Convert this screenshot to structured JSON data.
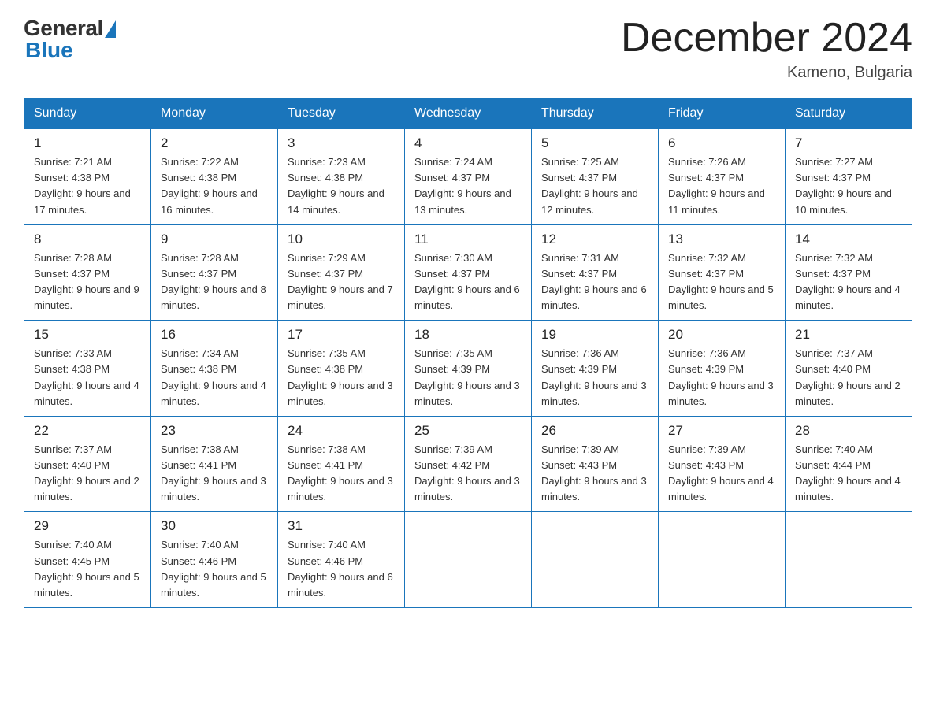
{
  "logo": {
    "general": "General",
    "blue": "Blue"
  },
  "title": "December 2024",
  "location": "Kameno, Bulgaria",
  "days_of_week": [
    "Sunday",
    "Monday",
    "Tuesday",
    "Wednesday",
    "Thursday",
    "Friday",
    "Saturday"
  ],
  "weeks": [
    [
      {
        "day": "1",
        "sunrise": "7:21 AM",
        "sunset": "4:38 PM",
        "daylight": "9 hours and 17 minutes."
      },
      {
        "day": "2",
        "sunrise": "7:22 AM",
        "sunset": "4:38 PM",
        "daylight": "9 hours and 16 minutes."
      },
      {
        "day": "3",
        "sunrise": "7:23 AM",
        "sunset": "4:38 PM",
        "daylight": "9 hours and 14 minutes."
      },
      {
        "day": "4",
        "sunrise": "7:24 AM",
        "sunset": "4:37 PM",
        "daylight": "9 hours and 13 minutes."
      },
      {
        "day": "5",
        "sunrise": "7:25 AM",
        "sunset": "4:37 PM",
        "daylight": "9 hours and 12 minutes."
      },
      {
        "day": "6",
        "sunrise": "7:26 AM",
        "sunset": "4:37 PM",
        "daylight": "9 hours and 11 minutes."
      },
      {
        "day": "7",
        "sunrise": "7:27 AM",
        "sunset": "4:37 PM",
        "daylight": "9 hours and 10 minutes."
      }
    ],
    [
      {
        "day": "8",
        "sunrise": "7:28 AM",
        "sunset": "4:37 PM",
        "daylight": "9 hours and 9 minutes."
      },
      {
        "day": "9",
        "sunrise": "7:28 AM",
        "sunset": "4:37 PM",
        "daylight": "9 hours and 8 minutes."
      },
      {
        "day": "10",
        "sunrise": "7:29 AM",
        "sunset": "4:37 PM",
        "daylight": "9 hours and 7 minutes."
      },
      {
        "day": "11",
        "sunrise": "7:30 AM",
        "sunset": "4:37 PM",
        "daylight": "9 hours and 6 minutes."
      },
      {
        "day": "12",
        "sunrise": "7:31 AM",
        "sunset": "4:37 PM",
        "daylight": "9 hours and 6 minutes."
      },
      {
        "day": "13",
        "sunrise": "7:32 AM",
        "sunset": "4:37 PM",
        "daylight": "9 hours and 5 minutes."
      },
      {
        "day": "14",
        "sunrise": "7:32 AM",
        "sunset": "4:37 PM",
        "daylight": "9 hours and 4 minutes."
      }
    ],
    [
      {
        "day": "15",
        "sunrise": "7:33 AM",
        "sunset": "4:38 PM",
        "daylight": "9 hours and 4 minutes."
      },
      {
        "day": "16",
        "sunrise": "7:34 AM",
        "sunset": "4:38 PM",
        "daylight": "9 hours and 4 minutes."
      },
      {
        "day": "17",
        "sunrise": "7:35 AM",
        "sunset": "4:38 PM",
        "daylight": "9 hours and 3 minutes."
      },
      {
        "day": "18",
        "sunrise": "7:35 AM",
        "sunset": "4:39 PM",
        "daylight": "9 hours and 3 minutes."
      },
      {
        "day": "19",
        "sunrise": "7:36 AM",
        "sunset": "4:39 PM",
        "daylight": "9 hours and 3 minutes."
      },
      {
        "day": "20",
        "sunrise": "7:36 AM",
        "sunset": "4:39 PM",
        "daylight": "9 hours and 3 minutes."
      },
      {
        "day": "21",
        "sunrise": "7:37 AM",
        "sunset": "4:40 PM",
        "daylight": "9 hours and 2 minutes."
      }
    ],
    [
      {
        "day": "22",
        "sunrise": "7:37 AM",
        "sunset": "4:40 PM",
        "daylight": "9 hours and 2 minutes."
      },
      {
        "day": "23",
        "sunrise": "7:38 AM",
        "sunset": "4:41 PM",
        "daylight": "9 hours and 3 minutes."
      },
      {
        "day": "24",
        "sunrise": "7:38 AM",
        "sunset": "4:41 PM",
        "daylight": "9 hours and 3 minutes."
      },
      {
        "day": "25",
        "sunrise": "7:39 AM",
        "sunset": "4:42 PM",
        "daylight": "9 hours and 3 minutes."
      },
      {
        "day": "26",
        "sunrise": "7:39 AM",
        "sunset": "4:43 PM",
        "daylight": "9 hours and 3 minutes."
      },
      {
        "day": "27",
        "sunrise": "7:39 AM",
        "sunset": "4:43 PM",
        "daylight": "9 hours and 4 minutes."
      },
      {
        "day": "28",
        "sunrise": "7:40 AM",
        "sunset": "4:44 PM",
        "daylight": "9 hours and 4 minutes."
      }
    ],
    [
      {
        "day": "29",
        "sunrise": "7:40 AM",
        "sunset": "4:45 PM",
        "daylight": "9 hours and 5 minutes."
      },
      {
        "day": "30",
        "sunrise": "7:40 AM",
        "sunset": "4:46 PM",
        "daylight": "9 hours and 5 minutes."
      },
      {
        "day": "31",
        "sunrise": "7:40 AM",
        "sunset": "4:46 PM",
        "daylight": "9 hours and 6 minutes."
      },
      null,
      null,
      null,
      null
    ]
  ]
}
